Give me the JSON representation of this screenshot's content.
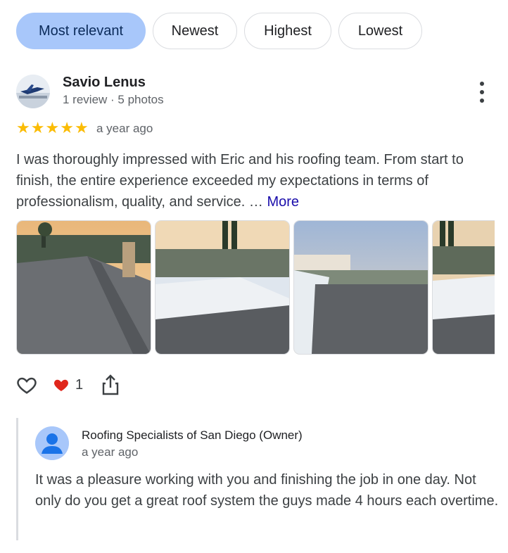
{
  "sort_chips": [
    {
      "label": "Most relevant",
      "active": true
    },
    {
      "label": "Newest",
      "active": false
    },
    {
      "label": "Highest",
      "active": false
    },
    {
      "label": "Lowest",
      "active": false
    }
  ],
  "review": {
    "author": "Savio Lenus",
    "meta": "1 review · 5 photos",
    "rating": 5,
    "rating_display": "★★★★★",
    "time": "a year ago",
    "text": "I was thoroughly impressed with Eric and his roofing team. From start to finish, the entire experience exceeded my expectations in terms of professionalism, quality, and service. …",
    "more_label": "More",
    "reaction_count": "1",
    "photos_visible": 4
  },
  "owner_reply": {
    "name": "Roofing Specialists of San Diego (Owner)",
    "time": "a year ago",
    "text": "It was a pleasure working with you and finishing the job in one day. Not only do you get a great roof system the guys made 4 hours each overtime."
  },
  "colors": {
    "accent_chip": "#a8c7fa",
    "star": "#fbbc04",
    "link": "#1a0dab",
    "heart": "#e0261b"
  },
  "icons": [
    "kebab-menu-icon",
    "like-icon",
    "heart-reaction-icon",
    "share-icon",
    "person-icon"
  ]
}
